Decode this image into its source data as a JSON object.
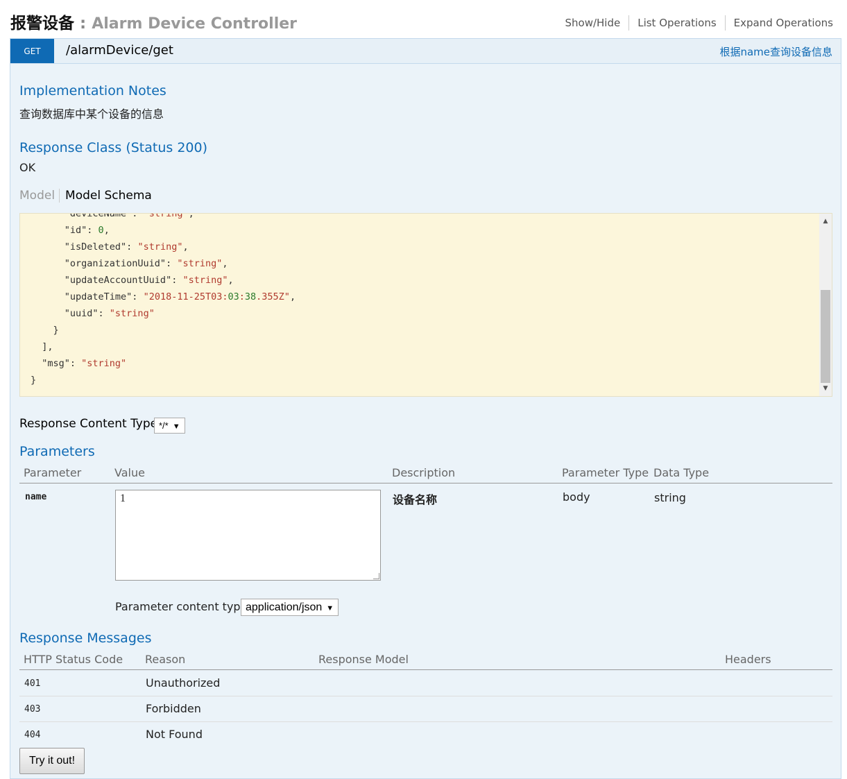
{
  "header": {
    "title_cn": "报警设备",
    "separator": " : ",
    "title_en": "Alarm Device Controller",
    "links": [
      "Show/Hide",
      "List Operations",
      "Expand Operations"
    ]
  },
  "operation": {
    "method": "GET",
    "path": "/alarmDevice/get",
    "summary": "根据name查询设备信息"
  },
  "implementation": {
    "heading": "Implementation Notes",
    "text": "查询数据库中某个设备的信息"
  },
  "response_class": {
    "heading": "Response Class (Status 200)",
    "text": "OK"
  },
  "schema_tabs": {
    "model": "Model",
    "schema": "Model Schema"
  },
  "schema_lines": [
    "      \"deviceName\": \"string\",",
    "      \"id\": 0,",
    "      \"isDeleted\": \"string\",",
    "      \"organizationUuid\": \"string\",",
    "      \"updateAccountUuid\": \"string\",",
    "      \"updateTime\": \"2018-11-25T03:03:38.355Z\",",
    "      \"uuid\": \"string\"",
    "    }",
    "  ],",
    "  \"msg\": \"string\"",
    "}"
  ],
  "response_content_type": {
    "label": "Response Content Type",
    "value": "*/*"
  },
  "parameters": {
    "heading": "Parameters",
    "columns": [
      "Parameter",
      "Value",
      "Description",
      "Parameter Type",
      "Data Type"
    ],
    "row": {
      "name": "name",
      "value": "1",
      "description": "设备名称",
      "param_type": "body",
      "data_type": "string"
    },
    "content_type_label": "Parameter content type:",
    "content_type_value": "application/json"
  },
  "response_messages": {
    "heading": "Response Messages",
    "columns": [
      "HTTP Status Code",
      "Reason",
      "Response Model",
      "Headers"
    ],
    "rows": [
      {
        "code": "401",
        "reason": "Unauthorized"
      },
      {
        "code": "403",
        "reason": "Forbidden"
      },
      {
        "code": "404",
        "reason": "Not Found"
      }
    ]
  },
  "try_button": "Try it out!",
  "colors": {
    "accent": "#0f6ab4",
    "panel": "#ebf3f9",
    "schema_bg": "#fcf6db"
  }
}
